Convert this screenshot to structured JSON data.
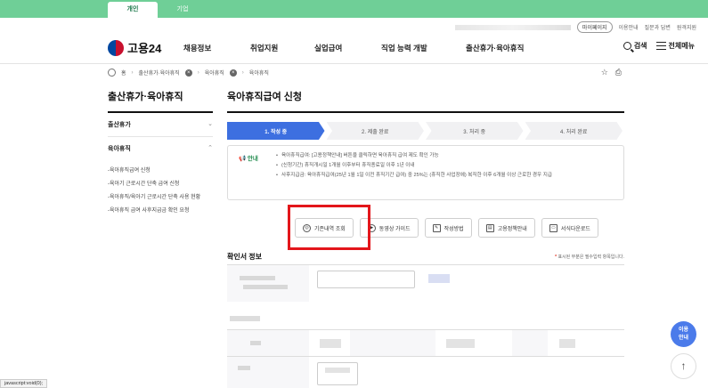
{
  "user_tabs": {
    "personal": "개인",
    "business": "기업"
  },
  "util": {
    "mypage": "마이페이지",
    "guide": "이용안내",
    "faq": "질문과 답변",
    "remote": "원격지원"
  },
  "logo": {
    "text": "고용24"
  },
  "gnb": [
    {
      "label": "채용정보"
    },
    {
      "label": "취업지원"
    },
    {
      "label": "실업급여"
    },
    {
      "label": "직업 능력 개발"
    },
    {
      "label": "출산휴가·육아휴직"
    }
  ],
  "actions": {
    "search": "검색",
    "all_menu": "전체메뉴"
  },
  "breadcrumb": {
    "home": "홈",
    "level1": "출산휴가·육아휴직",
    "level2": "육아휴직",
    "level3": "육아휴직"
  },
  "sidebar": {
    "title": "출산휴가·육아휴직",
    "sec1": "출산휴가",
    "sec2": "육아휴직",
    "items": [
      "-육아휴직급여 신청",
      "-육아기 근로시간 단축 급여 신청",
      "-육아휴직/육아기 근로시간 단축 사용 현황",
      "-육아휴직 급여 사후지급금 확인 요청"
    ]
  },
  "main": {
    "title": "육아휴직급여 신청"
  },
  "steps": [
    "1. 작성 중",
    "2. 제출 완료",
    "3. 처리 중",
    "4. 처리 완료"
  ],
  "notice": {
    "tag": "안내",
    "items": [
      "육아휴직급여: [고용정책안내] 버튼을 클릭하면 육아휴직 급여 제도 확인 가능",
      "(신청기간) 휴직개시일 1개월 이후부터 휴직종료일 이후 1년 이내",
      "사후지급금: 육아휴직급여(25년 1월 1일 이전 휴직기간 급여) 중 25%는 (휴직한 사업장에) 복직한 이후 6개월 이상 근로한 경우 지급"
    ]
  },
  "tools": [
    "기존내역 조회",
    "동영상 가이드",
    "작성방법",
    "고용정책안내",
    "서식다운로드"
  ],
  "form": {
    "section_title": "확인서 정보",
    "required_note": "표시된 부분은 필수입력 항목입니다."
  },
  "floating": {
    "use_guide": "이용\n안내",
    "top_arrow": "↑"
  },
  "statusbar": {
    "text": "javascript:void(0);"
  },
  "colors": {
    "topbar": "#6fcf97",
    "active_step": "#3d6fe0",
    "highlight": "#e3161b",
    "float": "#4b7bea"
  }
}
